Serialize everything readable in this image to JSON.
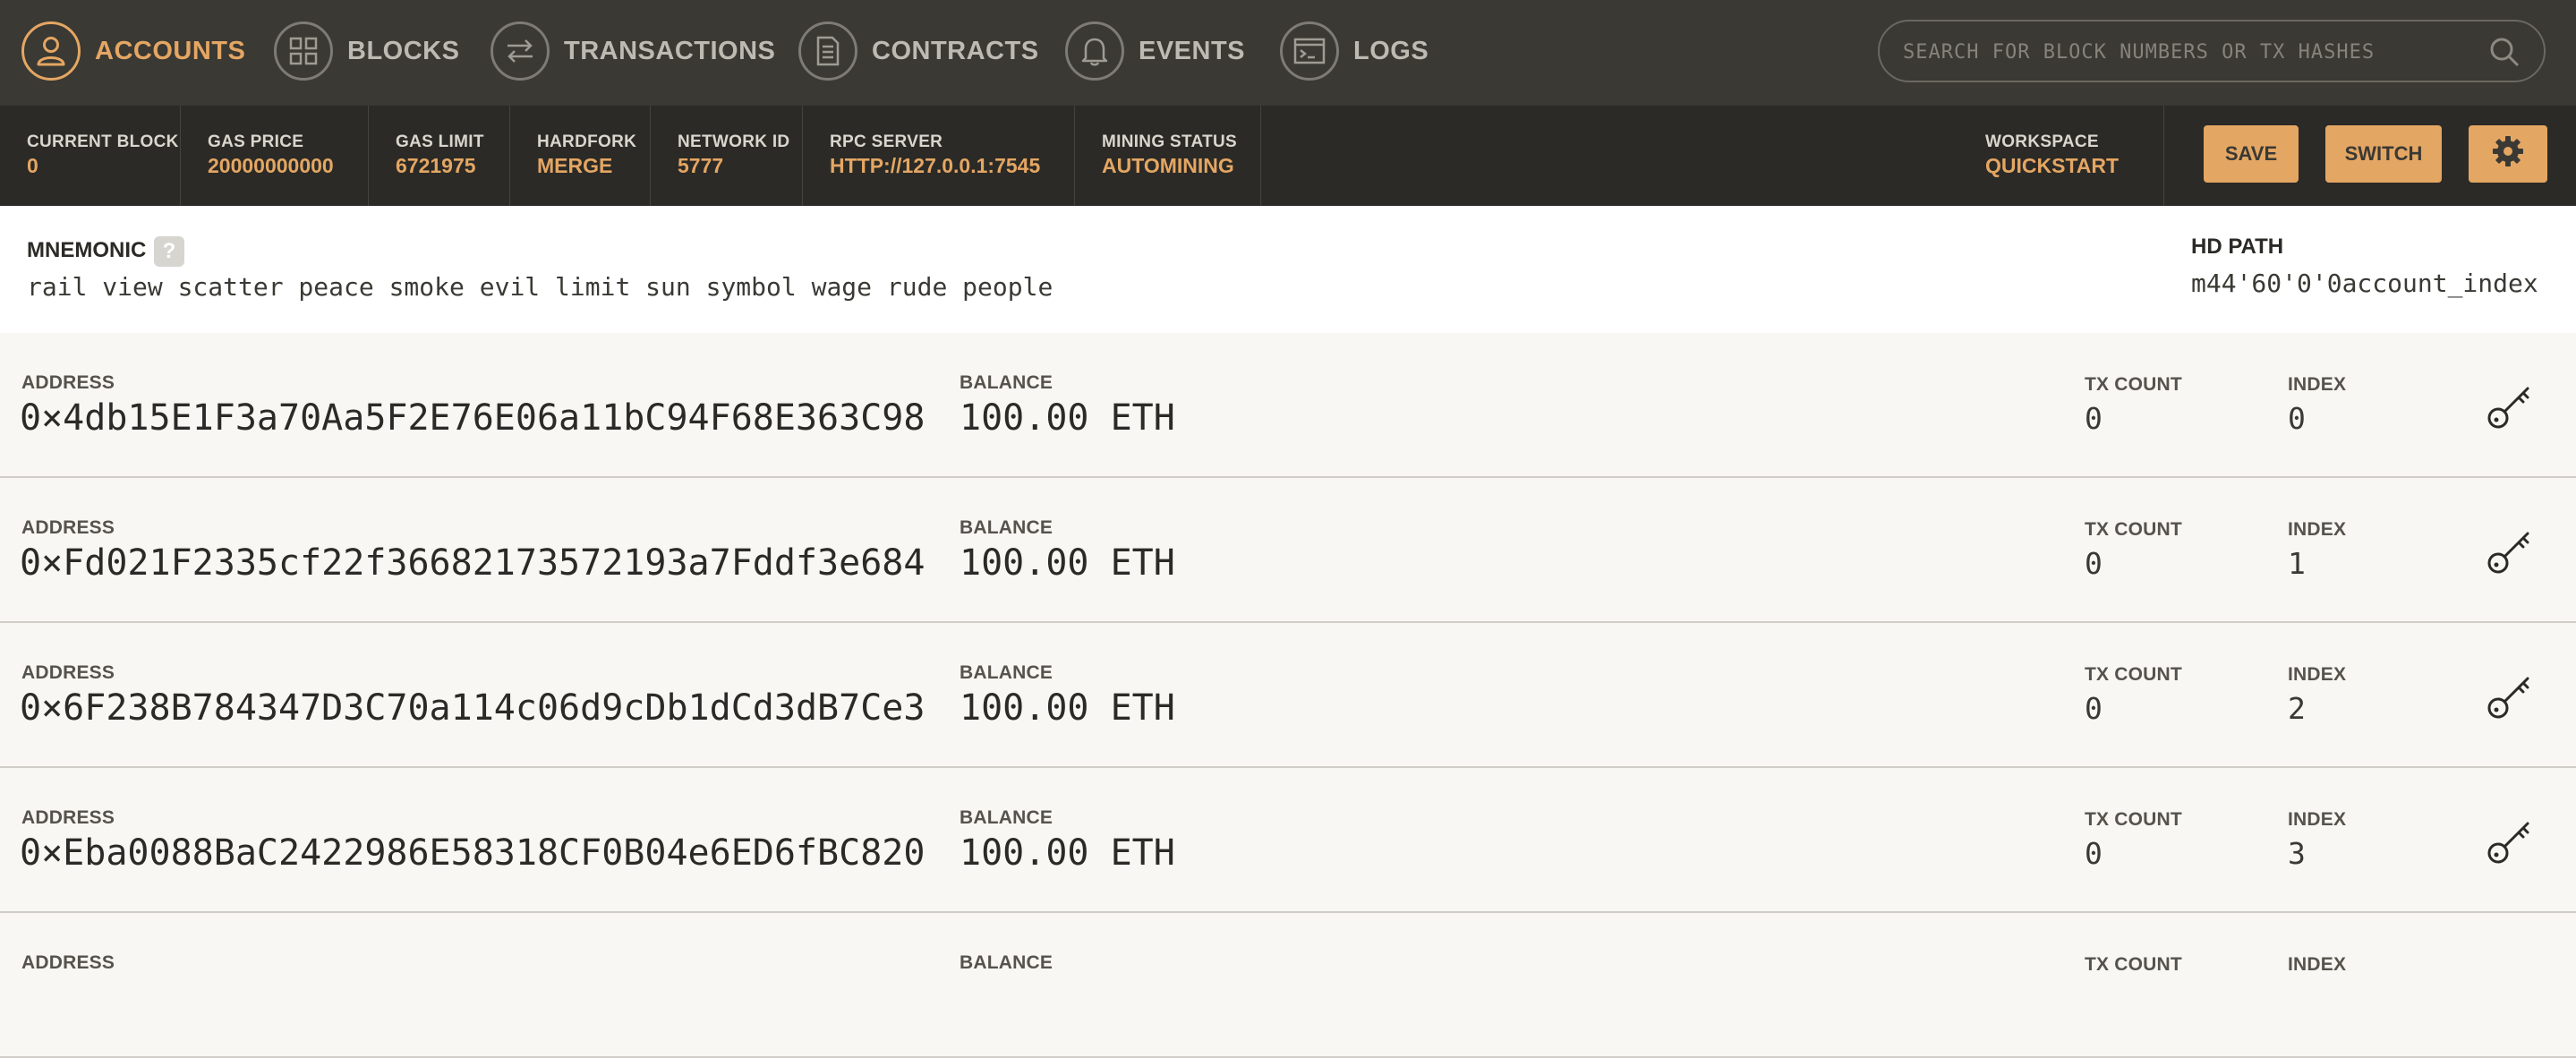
{
  "nav": {
    "items": [
      {
        "label": "ACCOUNTS",
        "icon": "user-icon",
        "active": true
      },
      {
        "label": "BLOCKS",
        "icon": "blocks-icon",
        "active": false
      },
      {
        "label": "TRANSACTIONS",
        "icon": "transactions-icon",
        "active": false
      },
      {
        "label": "CONTRACTS",
        "icon": "contracts-icon",
        "active": false
      },
      {
        "label": "EVENTS",
        "icon": "bell-icon",
        "active": false
      },
      {
        "label": "LOGS",
        "icon": "terminal-icon",
        "active": false
      }
    ],
    "search_placeholder": "SEARCH FOR BLOCK NUMBERS OR TX HASHES"
  },
  "status": {
    "current_block": {
      "label": "CURRENT BLOCK",
      "value": "0"
    },
    "gas_price": {
      "label": "GAS PRICE",
      "value": "20000000000"
    },
    "gas_limit": {
      "label": "GAS LIMIT",
      "value": "6721975"
    },
    "hardfork": {
      "label": "HARDFORK",
      "value": "MERGE"
    },
    "network_id": {
      "label": "NETWORK ID",
      "value": "5777"
    },
    "rpc_server": {
      "label": "RPC SERVER",
      "value": "HTTP://127.0.0.1:7545"
    },
    "mining_status": {
      "label": "MINING STATUS",
      "value": "AUTOMINING"
    },
    "workspace": {
      "label": "WORKSPACE",
      "value": "QUICKSTART"
    },
    "save_label": "SAVE",
    "switch_label": "SWITCH"
  },
  "mnemonic": {
    "title": "MNEMONIC",
    "help": "?",
    "words": "rail view scatter peace smoke evil limit sun symbol wage rude people",
    "hd_path_title": "HD PATH",
    "hd_path": "m44'60'0'0account_index"
  },
  "labels": {
    "address": "ADDRESS",
    "balance": "BALANCE",
    "tx_count": "TX COUNT",
    "index": "INDEX"
  },
  "accounts": [
    {
      "address": "0×4db15E1F3a70Aa5F2E76E06a11bC94F68E363C98",
      "balance": "100.00 ETH",
      "tx_count": "0",
      "index": "0"
    },
    {
      "address": "0×Fd021F2335cf22f36682173572193a7Fddf3e684",
      "balance": "100.00 ETH",
      "tx_count": "0",
      "index": "1"
    },
    {
      "address": "0×6F238B784347D3C70a114c06d9cDb1dCd3dB7Ce3",
      "balance": "100.00 ETH",
      "tx_count": "0",
      "index": "2"
    },
    {
      "address": "0×Eba0088BaC2422986E58318CF0B04e6ED6fBC820",
      "balance": "100.00 ETH",
      "tx_count": "0",
      "index": "3"
    },
    {
      "address": "",
      "balance": "",
      "tx_count": "",
      "index": ""
    }
  ],
  "colors": {
    "accent": "#e4a663",
    "nav_bg": "#3a3934",
    "status_bg": "#2b2a26",
    "content_bg": "#f8f7f3"
  }
}
